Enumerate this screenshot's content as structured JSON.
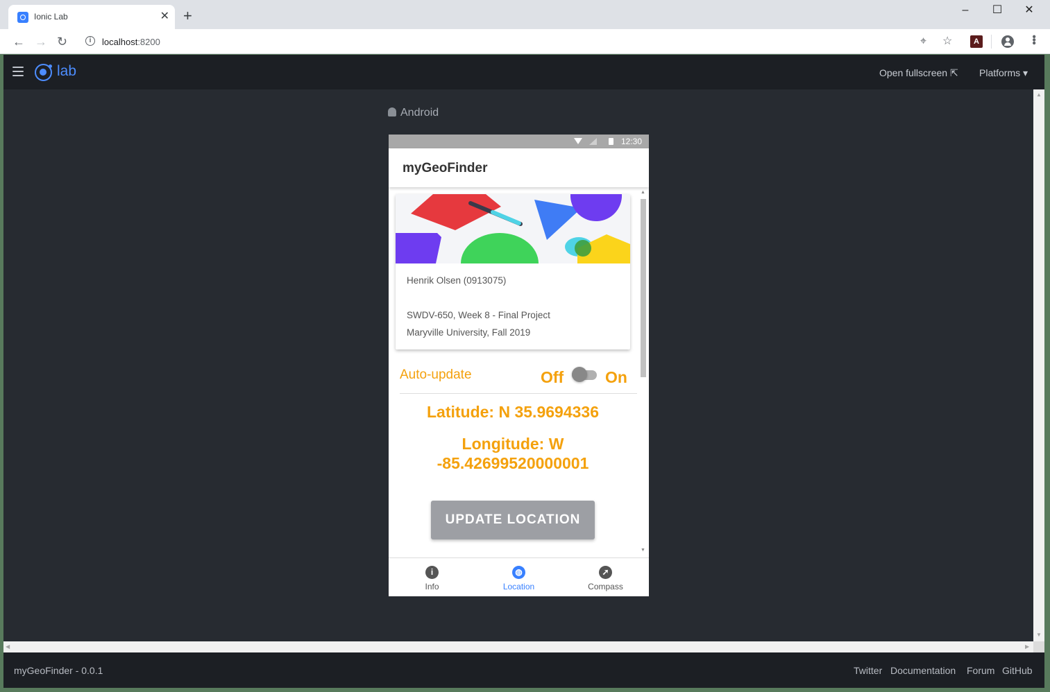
{
  "browser": {
    "tab_title": "Ionic Lab",
    "url_host": "localhost",
    "url_port": ":8200"
  },
  "lab": {
    "logo_text": "lab",
    "open_fullscreen": "Open fullscreen",
    "platforms": "Platforms",
    "platform_label": "Android",
    "footer_app": "myGeoFinder - 0.0.1",
    "footer_links": [
      "Twitter",
      "Documentation",
      "Forum",
      "GitHub"
    ]
  },
  "device": {
    "status_time": "12:30",
    "app_title": "myGeoFinder",
    "card": {
      "line1": "Henrik Olsen (0913075)",
      "line2": "SWDV-650, Week 8 - Final Project",
      "line3": "Maryville University, Fall 2019"
    },
    "auto_update": {
      "label": "Auto-update",
      "off": "Off",
      "on": "On",
      "state": "off"
    },
    "latitude": "Latitude: N 35.9694336",
    "longitude_line1": "Longitude: W",
    "longitude_line2": "-85.42699520000001",
    "update_button": "UPDATE LOCATION",
    "tabs": [
      {
        "label": "Info",
        "icon": "info-icon",
        "active": false
      },
      {
        "label": "Location",
        "icon": "globe-icon",
        "active": true
      },
      {
        "label": "Compass",
        "icon": "compass-icon",
        "active": false
      }
    ]
  },
  "colors": {
    "accent": "#f4a10d",
    "ionic_blue": "#3880ff",
    "lab_bg": "#272b31",
    "lab_header": "#1c1f24"
  }
}
